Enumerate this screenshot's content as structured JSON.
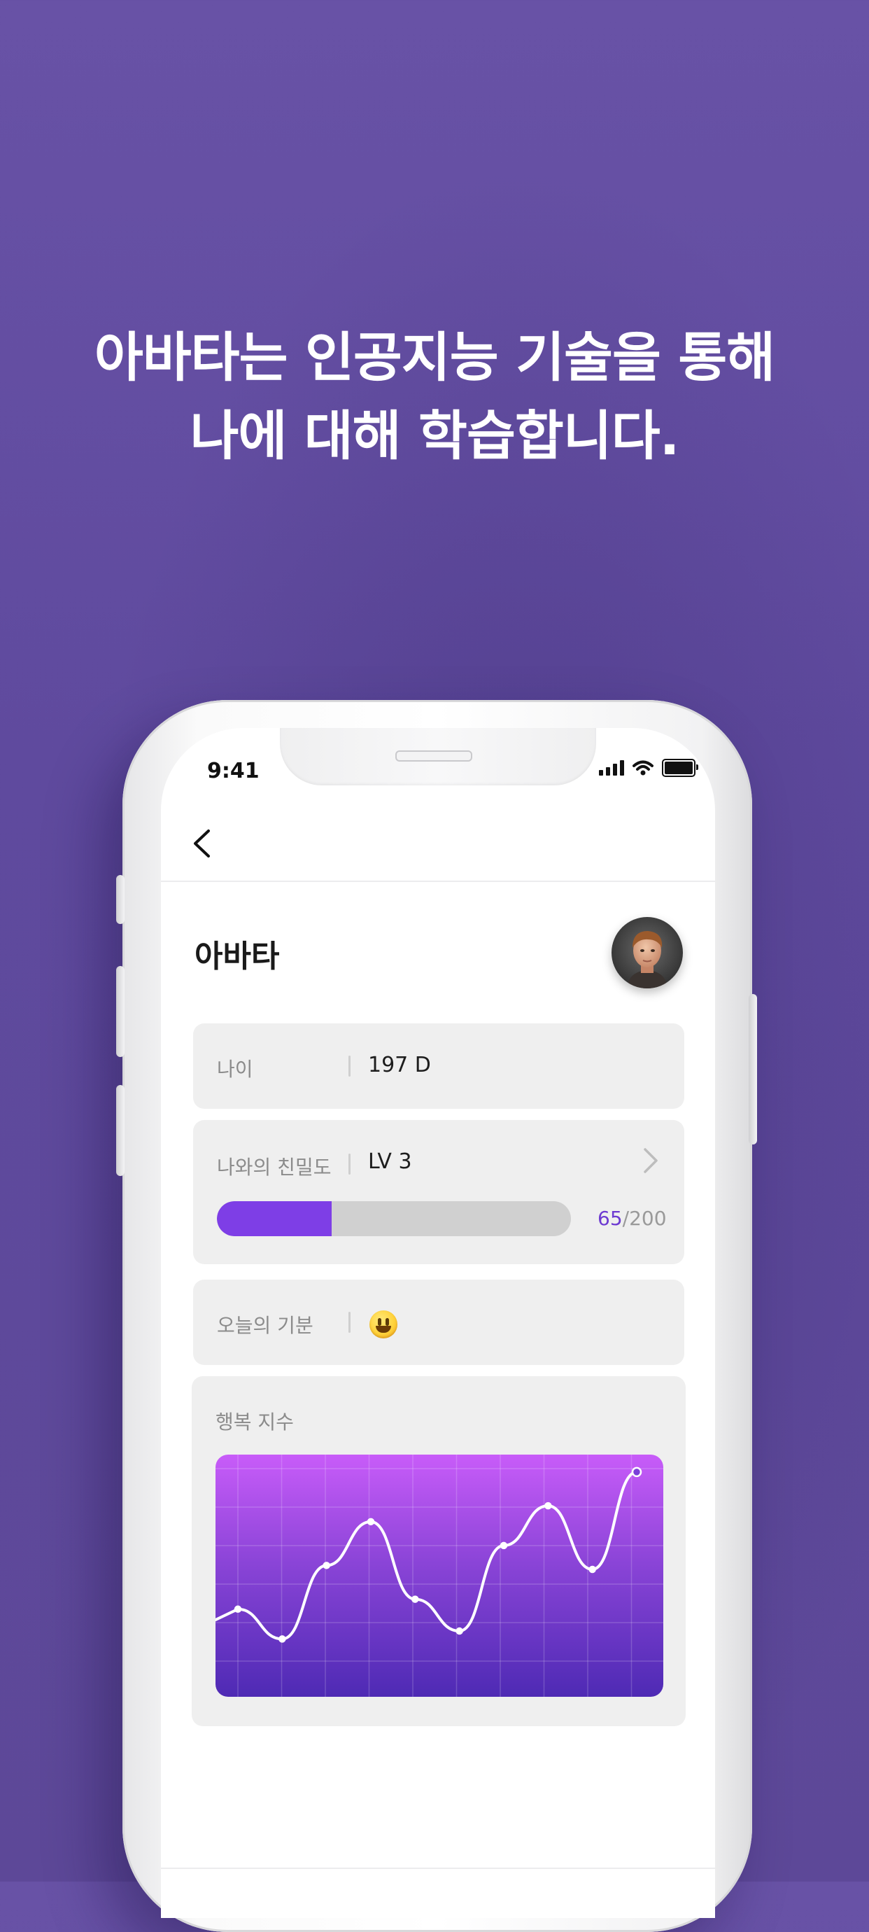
{
  "headline": {
    "line1": "아바타는 인공지능 기술을 통해",
    "line2": "나에 대해 학습합니다."
  },
  "status_bar": {
    "time": "9:41",
    "icons": [
      "signal-icon",
      "wifi-icon",
      "battery-icon"
    ]
  },
  "nav": {
    "back_icon": "chevron-left-icon"
  },
  "page": {
    "title": "아바타",
    "avatar": "avatar-photo"
  },
  "age_card": {
    "label": "나이",
    "value": "197 D"
  },
  "intimacy_card": {
    "label": "나와의 친밀도",
    "value": "LV 3",
    "chevron_icon": "chevron-right-icon",
    "progress_current": "65",
    "progress_total": "/200",
    "progress_fraction": 0.325
  },
  "mood_card": {
    "label": "오늘의 기분",
    "mood_icon": "smiling-face-icon"
  },
  "happiness_card": {
    "label": "행복 지수"
  },
  "colors": {
    "background": "#634ea2",
    "accent": "#7e3ee6",
    "chart_top": "#c85cf9",
    "chart_bottom": "#4e2ab4"
  },
  "chart_data": {
    "type": "line",
    "x": [
      0,
      1,
      2,
      3,
      4,
      5,
      6,
      7,
      8,
      9
    ],
    "values": [
      30,
      15,
      52,
      74,
      35,
      19,
      62,
      82,
      50,
      99
    ],
    "ylim": [
      0,
      100
    ],
    "grid": true,
    "title": "",
    "xlabel": "",
    "ylabel": ""
  }
}
